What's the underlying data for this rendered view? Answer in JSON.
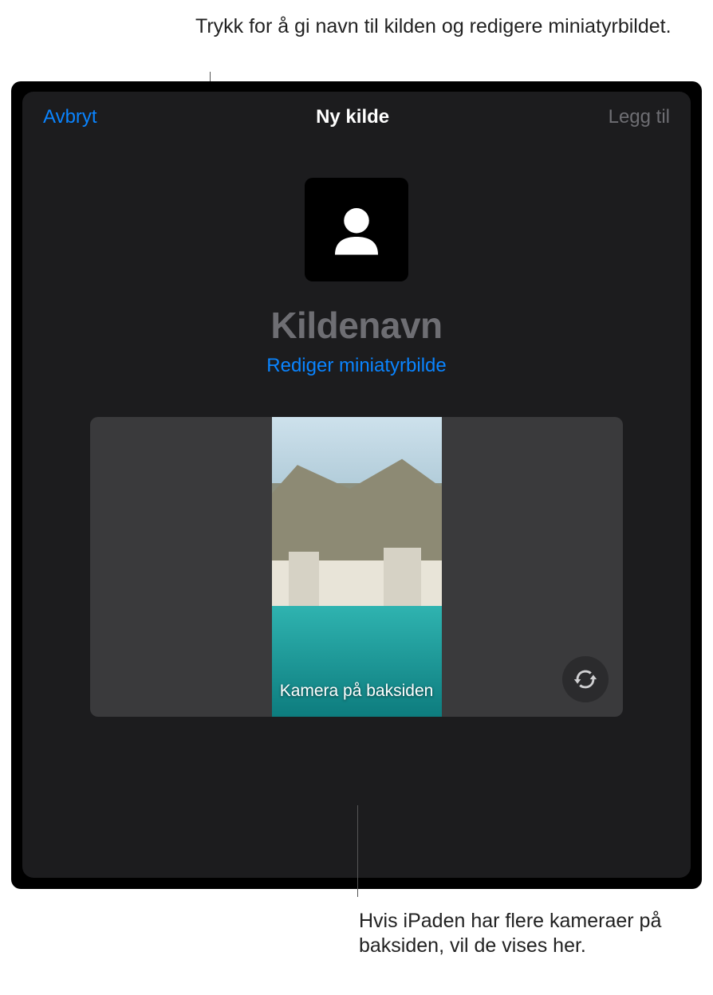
{
  "callouts": {
    "top": "Trykk for å gi navn til kilden og redigere miniatyrbildet.",
    "bottom": "Hvis iPaden har flere kameraer på baksiden, vil de vises her."
  },
  "modal": {
    "cancel_label": "Avbryt",
    "title": "Ny kilde",
    "add_label": "Legg til",
    "source_name_placeholder": "Kildenavn",
    "edit_thumbnail_label": "Rediger miniatyrbilde",
    "camera_label": "Kamera på baksiden"
  },
  "icons": {
    "avatar": "person-silhouette-icon",
    "flip": "camera-flip-icon"
  }
}
